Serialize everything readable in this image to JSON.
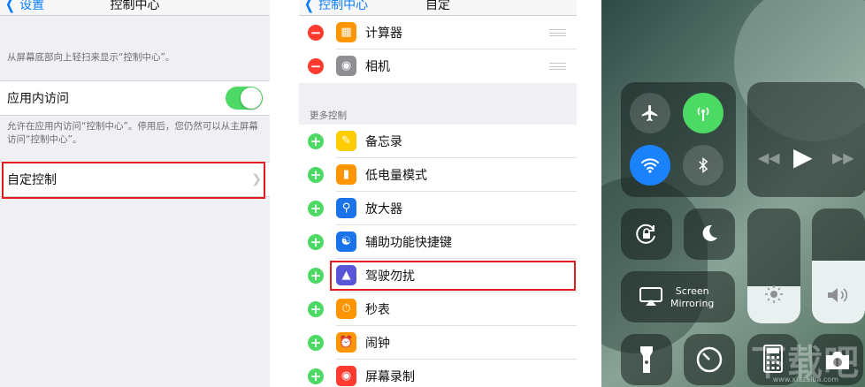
{
  "panel1": {
    "nav": {
      "back_label": "设置",
      "title": "控制中心"
    },
    "intro_note": "从屏幕底部向上轻扫来显示“控制中心”。",
    "app_access": {
      "label": "应用内访问",
      "enabled": true
    },
    "app_access_note": "允许在应用内访问“控制中心”。停用后，您仍然可以从主屏幕访问“控制中心”。",
    "customize": {
      "label": "自定控制"
    }
  },
  "panel2": {
    "nav": {
      "back_label": "控制中心",
      "title": "自定"
    },
    "included": [
      {
        "label": "计算器",
        "icon": "calculator-icon",
        "color": "#ff9500"
      },
      {
        "label": "相机",
        "icon": "camera-icon",
        "color": "#8e8e93"
      }
    ],
    "more_header": "更多控制",
    "more": [
      {
        "label": "备忘录",
        "icon": "notes-icon",
        "color": "#ffcc00"
      },
      {
        "label": "低电量模式",
        "icon": "battery-icon",
        "color": "#ff9500"
      },
      {
        "label": "放大器",
        "icon": "magnifier-icon",
        "color": "#1a73e8"
      },
      {
        "label": "辅助功能快捷键",
        "icon": "accessibility-icon",
        "color": "#1a73e8"
      },
      {
        "label": "驾驶勿扰",
        "icon": "car-icon",
        "color": "#5856d6"
      },
      {
        "label": "秒表",
        "icon": "stopwatch-icon",
        "color": "#ff9500"
      },
      {
        "label": "闹钟",
        "icon": "alarm-icon",
        "color": "#ff9500"
      },
      {
        "label": "屏幕录制",
        "icon": "record-icon",
        "color": "#ff3b30"
      }
    ]
  },
  "panel3": {
    "screen_mirroring_label": "Screen\nMirroring",
    "brightness_level": 0.32,
    "volume_level": 0.55,
    "watermark": "下载吧",
    "watermark_url": "www.xiazaiba.com"
  },
  "colors": {
    "ios_blue": "#0a7cff",
    "toggle_green": "#4cd964",
    "highlight_red": "#e21b23",
    "active_orange": "#ff9500",
    "airplane_on": "#ff9500",
    "cellular_on": "#4cd964",
    "wifi_on": "#1a82fb"
  }
}
